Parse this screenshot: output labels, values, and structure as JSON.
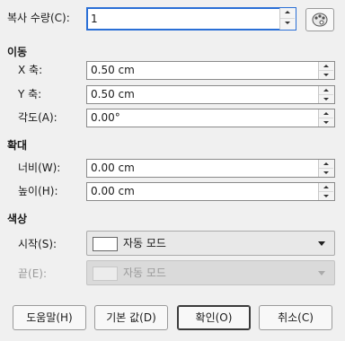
{
  "copies": {
    "label": "복사 수량(C):",
    "value": "1"
  },
  "move": {
    "heading": "이동",
    "x": {
      "label": "X 축:",
      "value": "0.50 cm"
    },
    "y": {
      "label": "Y 축:",
      "value": "0.50 cm"
    },
    "angle": {
      "label": "각도(A):",
      "value": "0.00°"
    }
  },
  "enlarge": {
    "heading": "확대",
    "width": {
      "label": "너비(W):",
      "value": "0.00 cm"
    },
    "height": {
      "label": "높이(H):",
      "value": "0.00 cm"
    }
  },
  "colors": {
    "heading": "색상",
    "start": {
      "label": "시작(S):",
      "value": "자동 모드"
    },
    "end": {
      "label": "끝(E):",
      "value": "자동 모드"
    }
  },
  "buttons": {
    "help": "도움말(H)",
    "defaults": "기본 값(D)",
    "ok": "확인(O)",
    "cancel": "취소(C)"
  },
  "icons": {
    "values_from_selection": "palette-icon"
  }
}
